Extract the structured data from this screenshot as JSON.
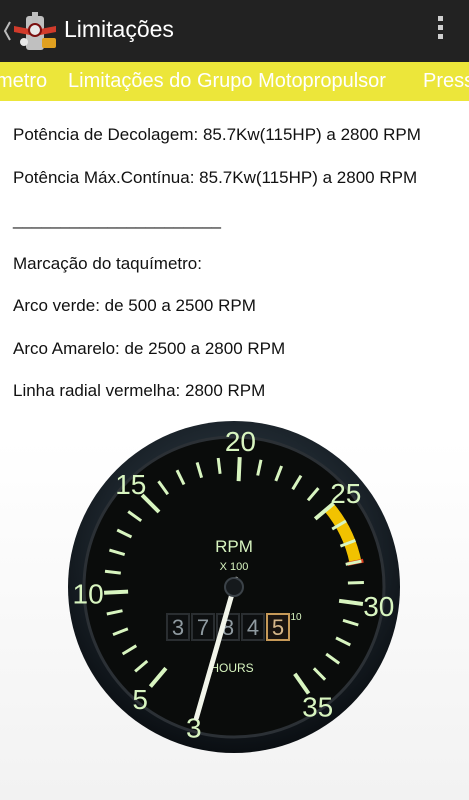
{
  "action_bar": {
    "title": "Limitações",
    "app_icon": "airplane-app-icon",
    "overflow_icon": "overflow-menu-icon"
  },
  "tabs": {
    "prev": "metro",
    "current": "Limitações do Grupo Motopropulsor",
    "next": "Press"
  },
  "content": {
    "line1": "Potência de Decolagem: 85.7Kw(115HP) a 2800 RPM",
    "line2": "Potência Máx.Contínua: 85.7Kw(115HP) a 2800 RPM",
    "separator": "______________________",
    "line3": "Marcação do taquímetro:",
    "line4": "Arco verde: de 500 a 2500 RPM",
    "line5": "Arco Amarelo: de 2500 a 2800 RPM",
    "line6": "Linha radial vermelha: 2800 RPM"
  },
  "tachometer": {
    "scale_labels": [
      "3",
      "5",
      "10",
      "15",
      "20",
      "25",
      "30",
      "35"
    ],
    "title": "RPM",
    "multiplier": "X 100",
    "hours_label": "HOURS",
    "hours_digits": [
      "3",
      "7",
      "8",
      "4",
      "5"
    ],
    "tenths_label": "10",
    "needle_value": 3,
    "green_arc": [
      5,
      25
    ],
    "yellow_arc": [
      25,
      28
    ],
    "red_line": 28,
    "colors": {
      "marking": "#d8f5c0",
      "yellow": "#f2c200",
      "red": "#d93a1b",
      "face": "#0a0c0b"
    }
  },
  "colors": {
    "action_bar": "#222222",
    "tab_strip": "#ece63a"
  }
}
